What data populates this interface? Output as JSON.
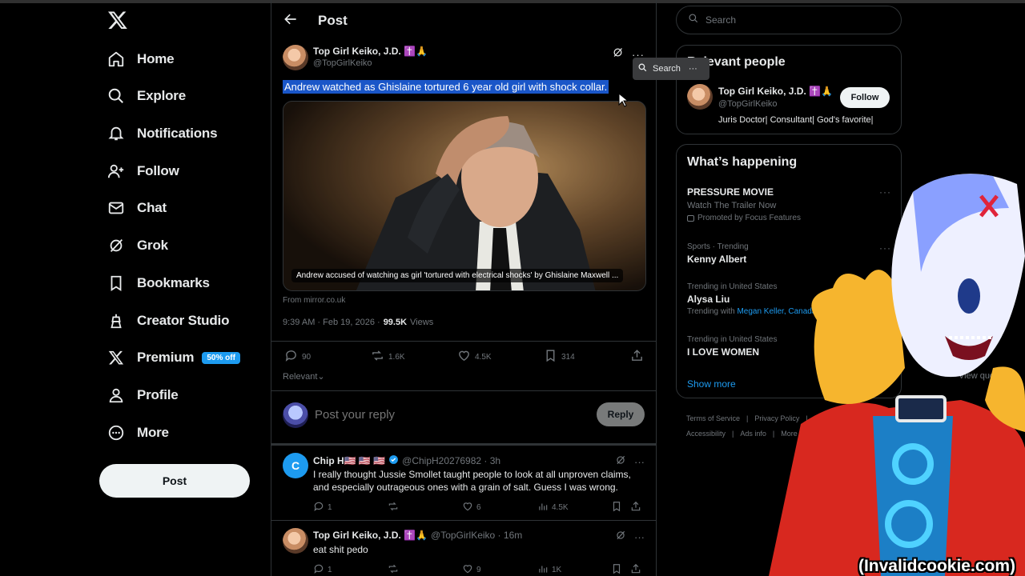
{
  "nav": {
    "items": [
      {
        "label": "Home",
        "icon": "home-icon"
      },
      {
        "label": "Explore",
        "icon": "search-icon"
      },
      {
        "label": "Notifications",
        "icon": "bell-icon"
      },
      {
        "label": "Follow",
        "icon": "follow-icon"
      },
      {
        "label": "Chat",
        "icon": "mail-icon"
      },
      {
        "label": "Grok",
        "icon": "grok-icon"
      },
      {
        "label": "Bookmarks",
        "icon": "bookmark-icon"
      },
      {
        "label": "Creator Studio",
        "icon": "creator-icon"
      },
      {
        "label": "Premium",
        "icon": "x-icon",
        "badge": "50% off"
      },
      {
        "label": "Profile",
        "icon": "profile-icon"
      },
      {
        "label": "More",
        "icon": "more-icon"
      }
    ],
    "post_button": "Post"
  },
  "header": {
    "title": "Post"
  },
  "main_post": {
    "author_name": "Top Girl Keiko, J.D. ✝️🙏",
    "handle": "@TopGirlKeiko",
    "text": "Andrew watched as Ghislaine tortured 6 year old girl with shock collar.",
    "media_caption": "Andrew accused of watching as girl 'tortured with electrical shocks' by Ghislaine Maxwell ...",
    "source": "From mirror.co.uk",
    "time": "9:39 AM · Feb 19, 2026 ·",
    "views_count": "99.5K",
    "views_label": "Views",
    "stats": {
      "replies": "90",
      "reposts": "1.6K",
      "likes": "4.5K",
      "bookmarks": "314"
    },
    "sort_label": "Relevant",
    "view_quotes": "View quotes"
  },
  "selection_popup": {
    "label": "Search"
  },
  "reply_box": {
    "placeholder": "Post your reply",
    "button": "Reply"
  },
  "comments": [
    {
      "avatar_letter": "C",
      "name": "Chip H🇺🇸 🇺🇸 🇺🇸",
      "handle": "@ChipH20276982 · 3h",
      "text": "I really thought Jussie Smollet taught people to look at all unproven claims, and especially outrageous ones with a grain of salt. Guess I was wrong.",
      "stats": {
        "replies": "1",
        "reposts": "",
        "likes": "6",
        "views": "4.5K"
      }
    },
    {
      "avatar_letter": "",
      "name": "Top Girl Keiko, J.D. ✝️🙏",
      "handle": "@TopGirlKeiko · 16m",
      "text": "eat shit pedo",
      "stats": {
        "replies": "1",
        "reposts": "",
        "likes": "9",
        "views": "1K"
      }
    }
  ],
  "sidebar": {
    "search_placeholder": "Search",
    "relevant": {
      "title": "Relevant people",
      "name": "Top Girl Keiko, J.D. ✝️🙏",
      "handle": "@TopGirlKeiko",
      "bio": "Juris Doctor| Consultant| God's favorite|",
      "follow": "Follow"
    },
    "happening": {
      "title": "What’s happening",
      "trends": [
        {
          "title": "PRESSURE MOVIE",
          "sub": "Watch The Trailer Now",
          "promo": "Promoted by Focus Features"
        },
        {
          "context": "Sports · Trending",
          "title": "Kenny Albert"
        },
        {
          "context": "Trending in United States",
          "title": "Alysa Liu",
          "with_label": "Trending with",
          "with": "Megan Keller, Canada"
        },
        {
          "context": "Trending in United States",
          "title": "I LOVE WOMEN"
        }
      ],
      "show_more": "Show more"
    },
    "footer": [
      "Terms of Service",
      "|",
      "Privacy Policy",
      "|",
      "Accessibility",
      "|",
      "Ads info",
      "|",
      "More ···"
    ]
  },
  "watermark": "(Invalidcookie.com)",
  "colors": {
    "accent": "#1d9bf0",
    "selection": "#1a56c8",
    "muted": "#71767b",
    "border": "#2f3336"
  }
}
